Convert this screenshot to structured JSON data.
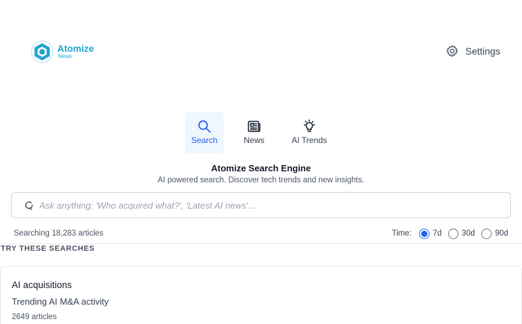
{
  "brand": {
    "name": "Atomize",
    "subname": "News",
    "color": "#22a5cf"
  },
  "header": {
    "settings_label": "Settings",
    "settings_icon": "gear-icon"
  },
  "tabs": [
    {
      "label": "Search",
      "icon": "search-icon",
      "active": true
    },
    {
      "label": "News",
      "icon": "newspaper-icon",
      "active": false
    },
    {
      "label": "AI Trends",
      "icon": "lightbulb-icon",
      "active": false
    }
  ],
  "engine": {
    "title": "Atomize Search Engine",
    "subtitle": "AI powered search. Discover tech trends and new insights."
  },
  "search": {
    "value": "",
    "placeholder": "Ask anything: 'Who acquired what?', 'Latest AI news'...",
    "icon": "loading-spinner-icon"
  },
  "status": {
    "article_count": "Searching 18,283 articles"
  },
  "time_filter": {
    "label": "Time:",
    "options": [
      {
        "label": "7d",
        "selected": true
      },
      {
        "label": "30d",
        "selected": false
      },
      {
        "label": "90d",
        "selected": false
      }
    ]
  },
  "suggestions": {
    "heading": "TRY THESE SEARCHES",
    "items": [
      {
        "title": "AI acquisitions",
        "description": "Trending AI M&A activity",
        "count": "2649 articles"
      }
    ]
  },
  "colors": {
    "accent": "#2563eb",
    "active_tab_bg": "#eff6ff",
    "border": "#d1d5db"
  }
}
